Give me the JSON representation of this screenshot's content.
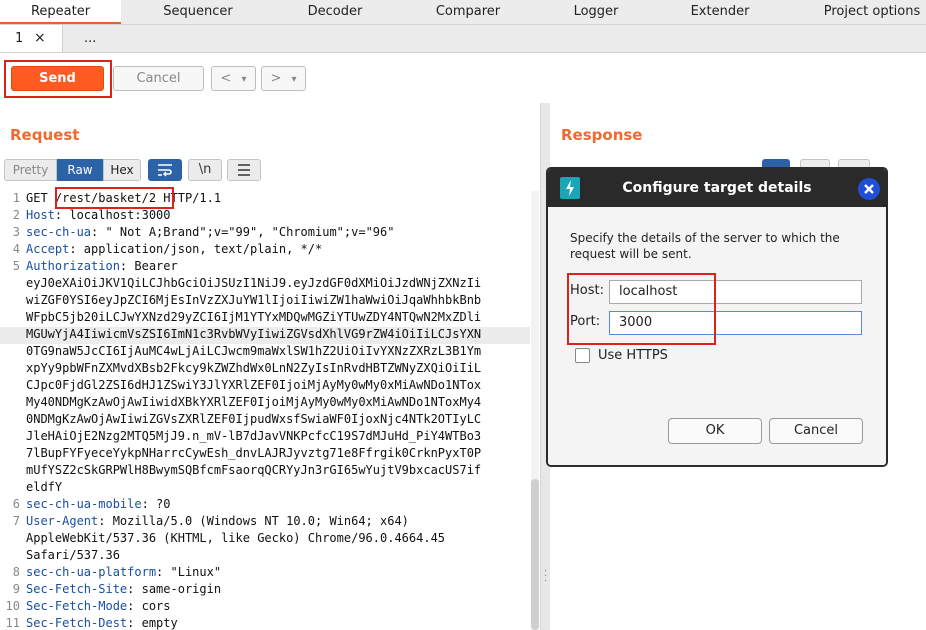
{
  "top_tabs": [
    "Repeater",
    "Sequencer",
    "Decoder",
    "Comparer",
    "Logger",
    "Extender",
    "Project options"
  ],
  "sub_tabs": {
    "first": "1",
    "close": "×",
    "more": "..."
  },
  "toolbar": {
    "send": "Send",
    "cancel": "Cancel",
    "back": "<",
    "forward": ">",
    "dropdown": "▾"
  },
  "request": {
    "title": "Request",
    "view_buttons": [
      "Pretty",
      "Raw",
      "Hex"
    ],
    "newline_button": "\\n",
    "lines": [
      {
        "n": "1",
        "key": "",
        "value": "GET /rest/basket/2 HTTP/1.1"
      },
      {
        "n": "2",
        "key": "Host",
        "value": ": localhost:3000"
      },
      {
        "n": "3",
        "key": "sec-ch-ua",
        "value": ": \" Not A;Brand\";v=\"99\", \"Chromium\";v=\"96\""
      },
      {
        "n": "4",
        "key": "Accept",
        "value": ": application/json, text/plain, */*"
      },
      {
        "n": "5",
        "key": "Authorization",
        "value": ": Bearer"
      },
      {
        "n": "",
        "key": "",
        "value": "eyJ0eXAiOiJKV1QiLCJhbGciOiJSUzI1NiJ9.eyJzdGF0dXMiOiJzdWNjZXNzIi"
      },
      {
        "n": "",
        "key": "",
        "value": "wiZGF0YSI6eyJpZCI6MjEsInVzZXJuYW1lIjoiIiwiZW1haWwiOiJqaWhhbkBnb"
      },
      {
        "n": "",
        "key": "",
        "value": "WFpbC5jb20iLCJwYXNzd29yZCI6IjM1YTYxMDQwMGZiYTUwZDY4NTQwN2MxZDli"
      },
      {
        "n": "",
        "key": "",
        "value": "MGUwYjA4IiwicmVsZSI6ImN1c3RvbWVyIiwiZGVsdXhlVG9rZW4iOiIiLCJsYXN"
      },
      {
        "n": "",
        "key": "",
        "value": "0TG9naW5JcCI6IjAuMC4wLjAiLCJwcm9maWxlSW1hZ2UiOiIvYXNzZXRzL3B1Ym"
      },
      {
        "n": "",
        "key": "",
        "value": "xpYy9pbWFnZXMvdXBsb2Fkcy9kZWZhdWx0LnN2ZyIsInRvdHBTZWNyZXQiOiIiL"
      },
      {
        "n": "",
        "key": "",
        "value": "CJpc0FjdGl2ZSI6dHJ1ZSwiY3JlYXRlZEF0IjoiMjAyMy0wMy0xMiAwNDo1NTox"
      },
      {
        "n": "",
        "key": "",
        "value": "My40NDMgKzAwOjAwIiwidXBkYXRlZEF0IjoiMjAyMy0wMy0xMiAwNDo1NToxMy4"
      },
      {
        "n": "",
        "key": "",
        "value": "0NDMgKzAwOjAwIiwiZGVsZXRlZEF0IjpudWxsfSwiaWF0IjoxNjc4NTk2OTIyLC"
      },
      {
        "n": "",
        "key": "",
        "value": "JleHAiOjE2Nzg2MTQ5MjJ9.n_mV-lB7dJavVNKPcfcC19S7dMJuHd_PiY4WTBo3"
      },
      {
        "n": "",
        "key": "",
        "value": "7lBupFYFyeceYykpNHarrcCywEsh_dnvLAJRJyvztg71e8Ffrgik0CrknPyxT0P"
      },
      {
        "n": "",
        "key": "",
        "value": "mUfYSZ2cSkGRPWlH8BwymSQBfcmFsaorqQCRYyJn3rGI65wYujtV9bxcacUS7if"
      },
      {
        "n": "",
        "key": "",
        "value": "eldfY"
      },
      {
        "n": "6",
        "key": "sec-ch-ua-mobile",
        "value": ": ?0"
      },
      {
        "n": "7",
        "key": "User-Agent",
        "value": ": Mozilla/5.0 (Windows NT 10.0; Win64; x64)"
      },
      {
        "n": "",
        "key": "",
        "value": "AppleWebKit/537.36 (KHTML, like Gecko) Chrome/96.0.4664.45"
      },
      {
        "n": "",
        "key": "",
        "value": "Safari/537.36"
      },
      {
        "n": "8",
        "key": "sec-ch-ua-platform",
        "value": ": \"Linux\""
      },
      {
        "n": "9",
        "key": "Sec-Fetch-Site",
        "value": ": same-origin"
      },
      {
        "n": "10",
        "key": "Sec-Fetch-Mode",
        "value": ": cors"
      },
      {
        "n": "11",
        "key": "Sec-Fetch-Dest",
        "value": ": empty"
      }
    ]
  },
  "response": {
    "title": "Response"
  },
  "dialog": {
    "title": "Configure target details",
    "description_line1": "Specify the details of the server to which the",
    "description_line2": "request will be sent.",
    "host_label": "Host:",
    "host_value": "localhost",
    "port_label": "Port:",
    "port_value": "3000",
    "https_label": "Use HTTPS",
    "ok": "OK",
    "cancel": "Cancel"
  },
  "colors": {
    "accent": "#ff5a1f",
    "highlight": "#e0201b",
    "dialog_header": "#2a2a2a",
    "close_icon": "#1e4fd6"
  }
}
